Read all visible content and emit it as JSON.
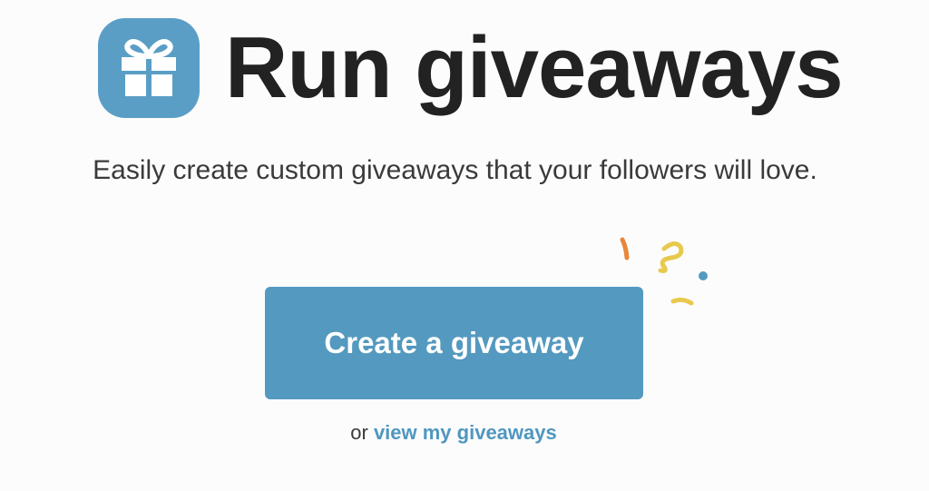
{
  "header": {
    "icon": "gift-icon",
    "title": "Run giveaways"
  },
  "subtitle": "Easily create custom giveaways that your followers will love.",
  "cta": {
    "label": "Create a giveaway",
    "decoration": "confetti-icon"
  },
  "secondary": {
    "prefix": "or",
    "link_label": "view my giveaways"
  },
  "colors": {
    "accent": "#5499bf",
    "link": "#4f97c0",
    "title_text": "#222222",
    "body_text": "#3a3a3a",
    "confetti": [
      "#e8873a",
      "#e8c94e",
      "#5499bf"
    ]
  }
}
